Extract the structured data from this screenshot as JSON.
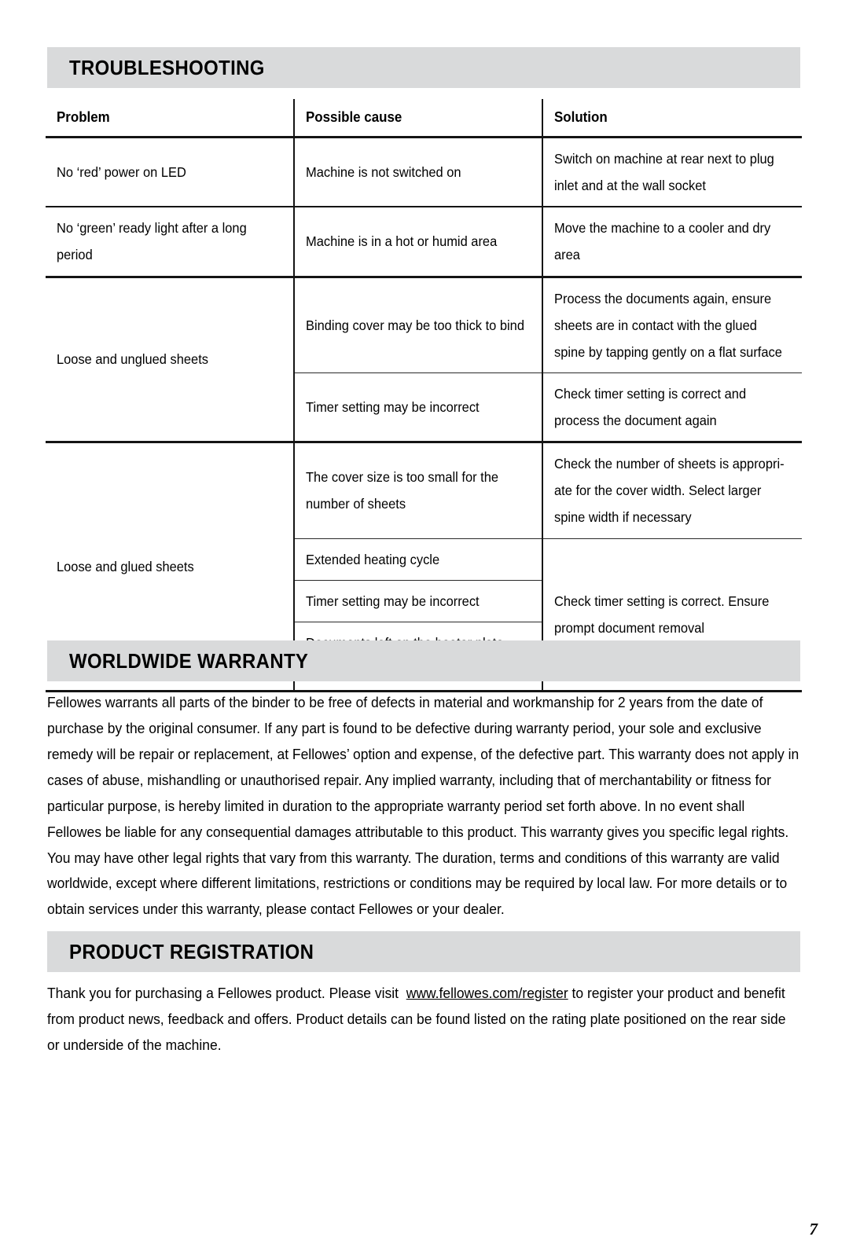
{
  "page": {
    "number": "7"
  },
  "troubleshooting": {
    "heading": "TROUBLESHOOTING",
    "columns": [
      "Problem",
      "Possible cause",
      "Solution"
    ],
    "rows": [
      {
        "problem": "No ‘red’ power on LED",
        "cause": "Machine is not switched on",
        "solution": "Switch on machine at rear next to plug inlet and at the wall socket"
      },
      {
        "problem": "No ‘green’ ready light after a long period",
        "cause": "Machine is in a hot or humid area",
        "solution": "Move the machine to a cooler and dry area"
      },
      {
        "problem": "Loose and unglued sheets",
        "cause": "Binding cover may be too thick to bind",
        "solution": "Process the documents again, ensure sheets are in contact with the glued spine by tapping gently on a flat surface"
      },
      {
        "problem": "",
        "cause": "Timer setting may be incorrect",
        "solution": "Check timer setting is correct and process the document again"
      },
      {
        "problem": "Loose and glued sheets",
        "cause": "The cover size is too small for the number of sheets",
        "solution": "Check the number of sheets is appropri­ate for the cover width. Select larger spine width if necessary"
      },
      {
        "problem": "",
        "cause": "Extended heating cycle",
        "solution": "Check timer setting is correct. Ensure prompt document removal"
      },
      {
        "problem": "",
        "cause": "Timer setting may be incorrect",
        "solution": ""
      },
      {
        "problem": "",
        "cause": "Documents left on the heater plate after the cycle is complete",
        "solution": ""
      }
    ]
  },
  "warranty": {
    "heading": "WORLDWIDE WARRANTY",
    "body": "Fellowes warrants all parts of the binder to be free of defects in material and workmanship for 2 years from the date of purchase by the original consumer. If any part is found to be defective during warranty period, your sole and exclusive remedy will be repair or replacement, at Fellowes’ option and expense, of the defective part. This warranty does not apply in cases of abuse, mishandling or unauthorised repair. Any implied warranty, including that of merchantability or fitness for particular purpose, is hereby limited in duration to the appropriate warranty period set forth above. In no event shall Fellowes be liable for any consequential damages attributable to this product. This warranty gives you specific legal rights. You may have other legal rights that vary from this warranty. The duration, terms and conditions of this warranty are valid worldwide, except where different limitations, restrictions or conditions may be required by local law. For more details or to obtain services under this warranty, please contact Fellowes or your dealer."
  },
  "registration": {
    "heading": "PRODUCT REGISTRATION",
    "body_before_link": "Thank you for purchasing a Fellowes product. Please visit",
    "link_text": "www.fellowes.com/register",
    "body_after_link": "to register your product and benefit from product news, feedback and offers. Product details can be found listed on the rating plate positioned on the rear side or underside of the machine."
  }
}
